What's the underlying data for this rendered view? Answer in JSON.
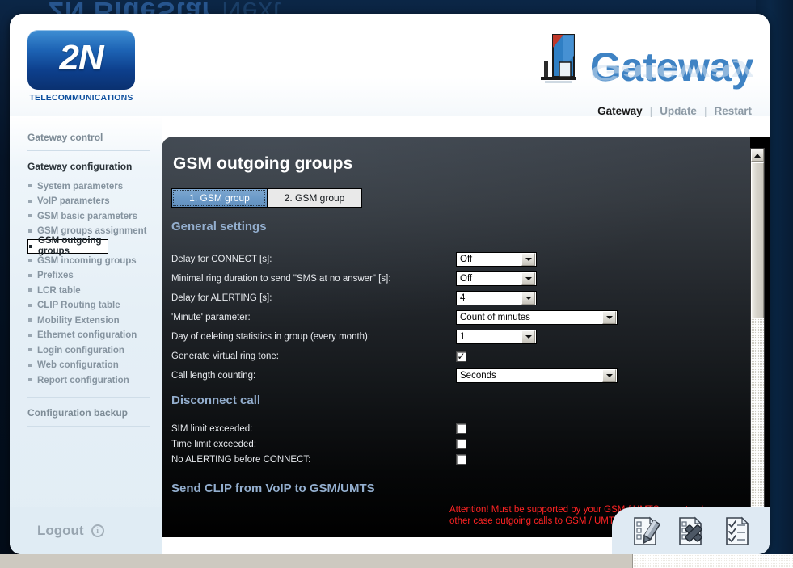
{
  "background": {
    "ghost_text_bold": "2N  BlueStar",
    "ghost_text_dim": " Next",
    "navy": "#061425"
  },
  "brand": {
    "logo_text": "2N",
    "logo_sub": "TELECOMMUNICATIONS",
    "product": "Gateway"
  },
  "topnav": {
    "items": [
      {
        "label": "Gateway",
        "active": true
      },
      {
        "label": "Update",
        "active": false
      },
      {
        "label": "Restart",
        "active": false
      }
    ],
    "separator": "|"
  },
  "sidebar": {
    "section_control": "Gateway control",
    "section_config": "Gateway configuration",
    "items": [
      {
        "label": "System parameters",
        "selected": false
      },
      {
        "label": "VoIP parameters",
        "selected": false
      },
      {
        "label": "GSM basic parameters",
        "selected": false
      },
      {
        "label": "GSM groups assignment",
        "selected": false
      },
      {
        "label": "GSM outgoing groups",
        "selected": true
      },
      {
        "label": "GSM incoming groups",
        "selected": false
      },
      {
        "label": "Prefixes",
        "selected": false
      },
      {
        "label": "LCR table",
        "selected": false
      },
      {
        "label": "CLIP Routing table",
        "selected": false
      },
      {
        "label": "Mobility Extension",
        "selected": false
      },
      {
        "label": "Ethernet configuration",
        "selected": false
      },
      {
        "label": "Login configuration",
        "selected": false
      },
      {
        "label": "Web configuration",
        "selected": false
      },
      {
        "label": "Report configuration",
        "selected": false
      }
    ],
    "section_backup": "Configuration backup",
    "logout_label": "Logout",
    "logout_info_glyph": "i"
  },
  "main": {
    "title": "GSM outgoing groups",
    "tabs": [
      {
        "label": "1. GSM group",
        "active": true
      },
      {
        "label": "2. GSM group",
        "active": false
      }
    ],
    "sections": {
      "general": "General settings",
      "disconnect": "Disconnect call",
      "clip": "Send CLIP from VoIP to GSM/UMTS"
    },
    "general_rows": [
      {
        "label": "Delay for CONNECT [s]:",
        "type": "select",
        "value": "Off",
        "width": "narrow"
      },
      {
        "label": "Minimal ring duration to send \"SMS at no answer\" [s]:",
        "type": "select",
        "value": "Off",
        "width": "narrow"
      },
      {
        "label": "Delay for ALERTING [s]:",
        "type": "select",
        "value": "4",
        "width": "narrow"
      },
      {
        "label": "'Minute' parameter:",
        "type": "select",
        "value": "Count of minutes",
        "width": "wide"
      },
      {
        "label": "Day of deleting statistics in group (every month):",
        "type": "select",
        "value": "1",
        "width": "narrow"
      },
      {
        "label": "Generate virtual ring tone:",
        "type": "checkbox",
        "checked": true
      },
      {
        "label": "Call length counting:",
        "type": "select",
        "value": "Seconds",
        "width": "wide"
      }
    ],
    "disconnect_rows": [
      {
        "label": "SIM limit exceeded:",
        "type": "checkbox",
        "checked": false
      },
      {
        "label": "Time limit exceeded:",
        "type": "checkbox",
        "checked": false
      },
      {
        "label": "No ALERTING before CONNECT:",
        "type": "checkbox",
        "checked": false
      }
    ],
    "warning": "Attention! Must be supported by your GSM / UMTS operator. In other case outgoing calls to GSM / UMTS can be rejected!",
    "warning_color": "#ff2424"
  },
  "scrollbar": {
    "up_glyph": "▲",
    "down_glyph": "▼",
    "thumb_position_percent": 0,
    "thumb_size_percent": 43
  },
  "actions": [
    {
      "name": "edit-document-icon",
      "label": "Edit"
    },
    {
      "name": "delete-document-icon",
      "label": "Delete"
    },
    {
      "name": "apply-checklist-icon",
      "label": "Apply"
    }
  ]
}
